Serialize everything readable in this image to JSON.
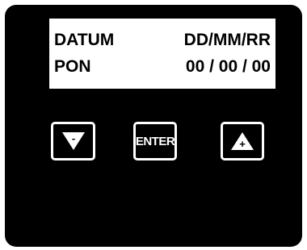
{
  "display": {
    "row1_label": "DATUM",
    "row1_value": "DD/MM/RR",
    "row2_label": "PON",
    "row2_value": "00 / 00 / 00"
  },
  "keys": {
    "down": {
      "icon": "triangle-down-minus-icon",
      "symbol": "-"
    },
    "enter": {
      "label": "ENTER"
    },
    "up": {
      "icon": "triangle-up-plus-icon",
      "symbol": "+"
    }
  },
  "colors": {
    "panel": "#000000",
    "screen": "#ffffff",
    "key_border": "#ffffff"
  }
}
